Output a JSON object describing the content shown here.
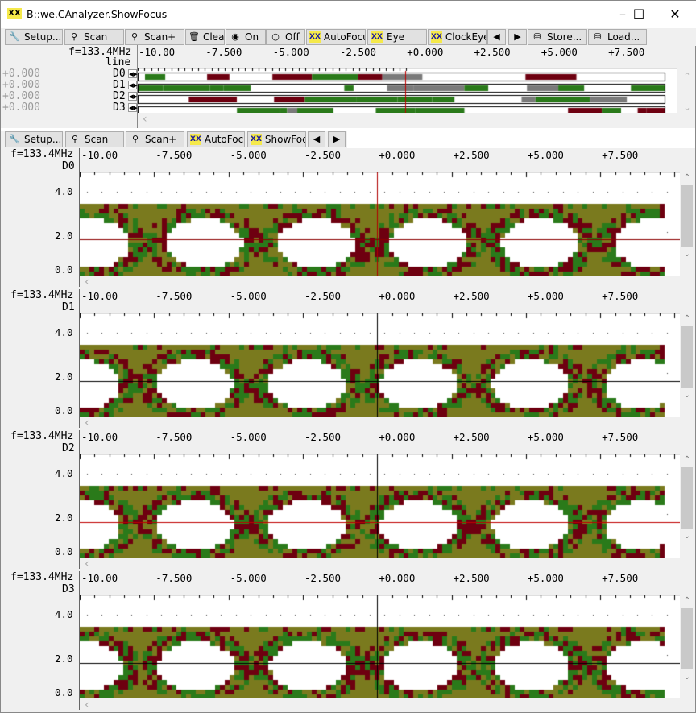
{
  "window": {
    "title": "B::we.CAnalyzer.ShowFocus",
    "icon": "eye-pattern-icon"
  },
  "toolbar": [
    {
      "label": "Setup...",
      "icon": "wrench-icon"
    },
    {
      "label": "Scan",
      "icon": "scan-magnifier-icon"
    },
    {
      "label": "Scan+",
      "icon": "scan-magnifier-icon"
    },
    {
      "label": "Clear",
      "icon": "trash-icon"
    },
    {
      "label": "On",
      "icon": "radio-on-icon"
    },
    {
      "label": "Off",
      "icon": "radio-off-icon"
    },
    {
      "label": "AutoFocus",
      "icon": "autofocus-icon"
    },
    {
      "label": "Eye",
      "icon": "eye-pattern-icon"
    },
    {
      "label": "ClockEye",
      "icon": "eye-pattern-icon"
    },
    {
      "label": "",
      "icon": "arrow-left-icon"
    },
    {
      "label": "",
      "icon": "arrow-right-icon"
    },
    {
      "label": "Store...",
      "icon": "store-icon"
    },
    {
      "label": "Load...",
      "icon": "load-icon"
    }
  ],
  "overview": {
    "freq": "f=133.4MHz",
    "col": "line",
    "xticks": [
      "-10.00",
      "-7.500",
      "-5.000",
      "-2.500",
      "+0.000",
      "+2.500",
      "+5.000",
      "+7.500"
    ],
    "rows": [
      {
        "name": "D0",
        "offset": "+0.000"
      },
      {
        "name": "D1",
        "offset": "+0.000"
      },
      {
        "name": "D2",
        "offset": "+0.000"
      },
      {
        "name": "D3",
        "offset": "+0.000"
      }
    ]
  },
  "toolbar2": [
    {
      "label": "Setup...",
      "icon": "wrench-icon"
    },
    {
      "label": "Scan",
      "icon": "scan-magnifier-icon"
    },
    {
      "label": "Scan+",
      "icon": "scan-magnifier-icon"
    },
    {
      "label": "AutoFocus",
      "icon": "autofocus-icon"
    },
    {
      "label": "ShowFocus",
      "icon": "eye-pattern-icon"
    },
    {
      "label": "",
      "icon": "arrow-left-icon"
    },
    {
      "label": "",
      "icon": "arrow-right-icon"
    }
  ],
  "panels": [
    {
      "freq": "f=133.4MHz",
      "name": "D0",
      "crosshair_v": "#b00000",
      "crosshair_h": "#8b0000"
    },
    {
      "freq": "f=133.4MHz",
      "name": "D1",
      "crosshair_v": "#000000",
      "crosshair_h": "#000000"
    },
    {
      "freq": "f=133.4MHz",
      "name": "D2",
      "crosshair_v": "#000000",
      "crosshair_h": "#c00000"
    },
    {
      "freq": "f=133.4MHz",
      "name": "D3",
      "crosshair_v": "#000000",
      "crosshair_h": "#000000"
    }
  ],
  "xticks": [
    "-10.00",
    "-7.500",
    "-5.000",
    "-2.500",
    "+0.000",
    "+2.500",
    "+5.000",
    "+7.500"
  ],
  "yticks": [
    "4.0",
    "2.0",
    "0.0"
  ],
  "colors": {
    "olive": "#7a7a1e",
    "green": "#2a7a1a",
    "red": "#6e0010",
    "gray": "#7a7a7a"
  }
}
